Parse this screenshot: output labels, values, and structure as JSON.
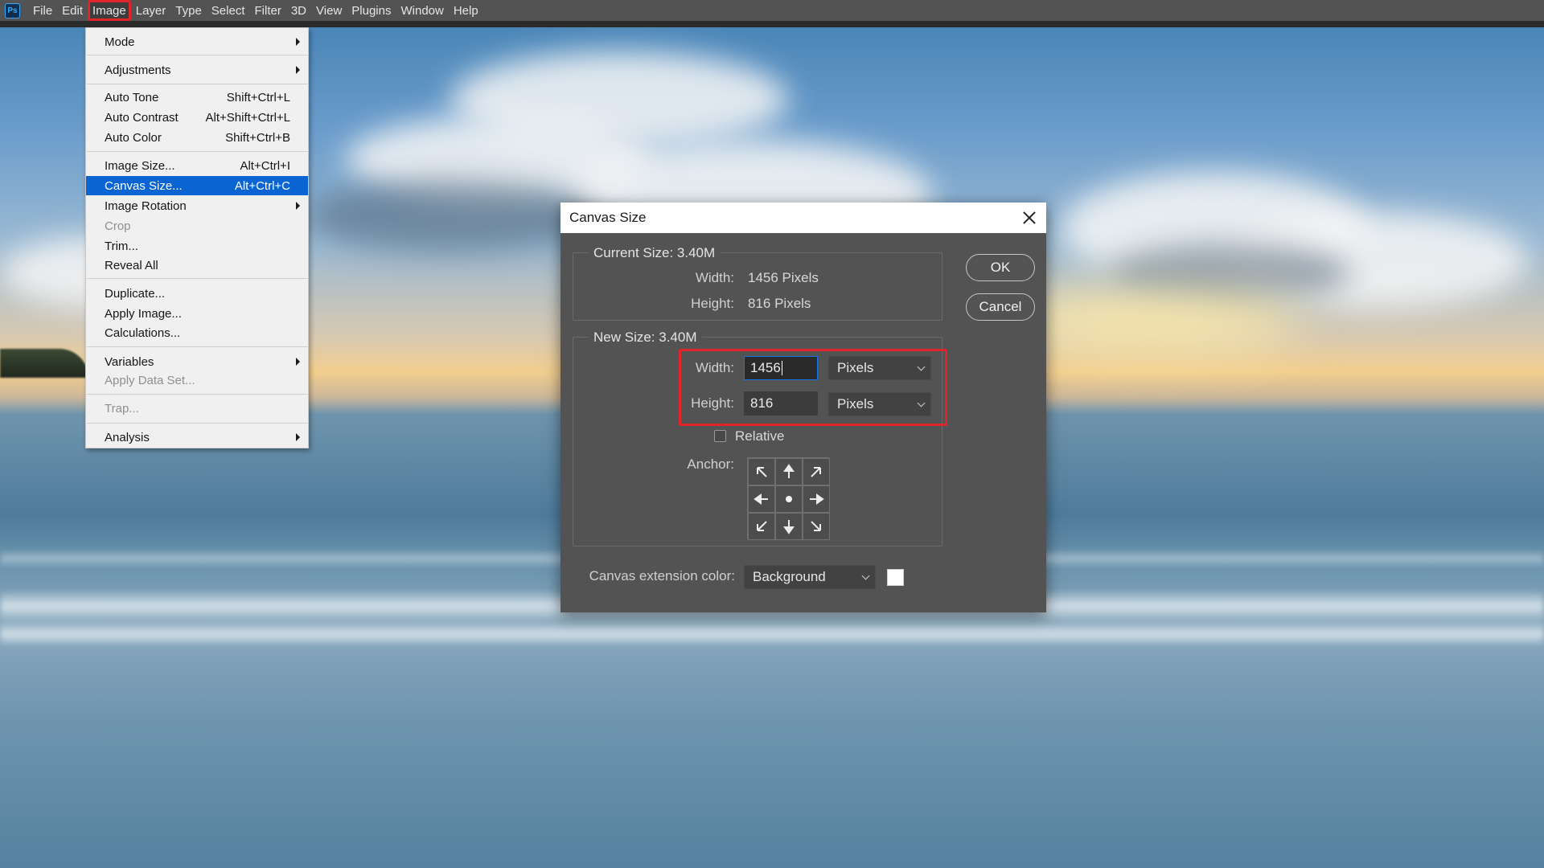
{
  "app": {
    "logo": "Ps"
  },
  "menubar": {
    "items": [
      "File",
      "Edit",
      "Image",
      "Layer",
      "Type",
      "Select",
      "Filter",
      "3D",
      "View",
      "Plugins",
      "Window",
      "Help"
    ],
    "active": "Image"
  },
  "image_menu": {
    "items": [
      {
        "label": "Mode",
        "shortcut": "",
        "submenu": true
      },
      {
        "label": "Adjustments",
        "shortcut": "",
        "submenu": true
      },
      {
        "label": "Auto Tone",
        "shortcut": "Shift+Ctrl+L"
      },
      {
        "label": "Auto Contrast",
        "shortcut": "Alt+Shift+Ctrl+L"
      },
      {
        "label": "Auto Color",
        "shortcut": "Shift+Ctrl+B"
      },
      {
        "label": "Image Size...",
        "shortcut": "Alt+Ctrl+I"
      },
      {
        "label": "Canvas Size...",
        "shortcut": "Alt+Ctrl+C",
        "selected": true
      },
      {
        "label": "Image Rotation",
        "shortcut": "",
        "submenu": true
      },
      {
        "label": "Crop",
        "shortcut": "",
        "disabled": true
      },
      {
        "label": "Trim...",
        "shortcut": ""
      },
      {
        "label": "Reveal All",
        "shortcut": ""
      },
      {
        "label": "Duplicate...",
        "shortcut": ""
      },
      {
        "label": "Apply Image...",
        "shortcut": ""
      },
      {
        "label": "Calculations...",
        "shortcut": ""
      },
      {
        "label": "Variables",
        "shortcut": "",
        "submenu": true
      },
      {
        "label": "Apply Data Set...",
        "shortcut": "",
        "disabled": true
      },
      {
        "label": "Trap...",
        "shortcut": "",
        "disabled": true
      },
      {
        "label": "Analysis",
        "shortcut": "",
        "submenu": true
      }
    ]
  },
  "dialog": {
    "title": "Canvas Size",
    "current_size": {
      "legend": "Current Size: 3.40M",
      "width_label": "Width:",
      "width_value": "1456 Pixels",
      "height_label": "Height:",
      "height_value": "816 Pixels"
    },
    "new_size": {
      "legend": "New Size: 3.40M",
      "width_label": "Width:",
      "width_value": "1456",
      "width_unit": "Pixels",
      "height_label": "Height:",
      "height_value": "816",
      "height_unit": "Pixels",
      "relative_label": "Relative",
      "relative_checked": false,
      "anchor_label": "Anchor:"
    },
    "extension": {
      "label": "Canvas extension color:",
      "value": "Background",
      "swatch_color": "#ffffff"
    },
    "ok_label": "OK",
    "cancel_label": "Cancel"
  },
  "colors": {
    "highlight": "#e0242b",
    "menu_selected": "#0a64d2",
    "dialog_bg": "#535353"
  }
}
